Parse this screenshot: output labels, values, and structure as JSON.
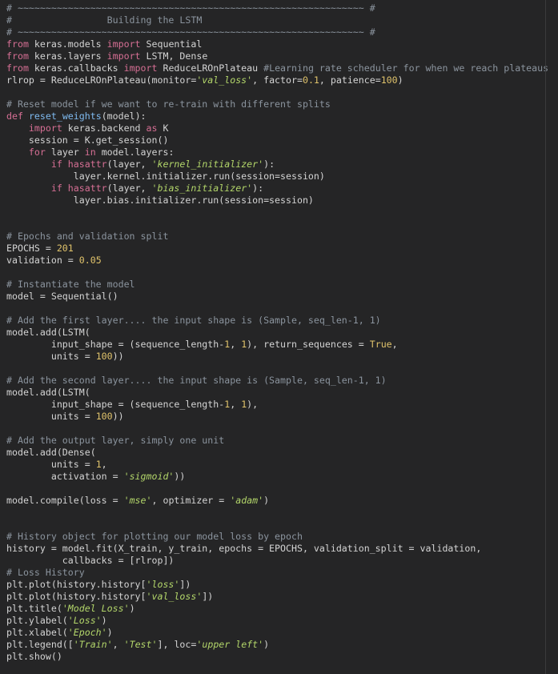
{
  "colors": {
    "background": "#252526",
    "text": "#d4d4d4",
    "keyword": "#d66f94",
    "comment": "#8b949e",
    "string": "#b3d66a",
    "number": "#e0c36b",
    "function": "#7fbaf0"
  },
  "code": {
    "lines": [
      [
        {
          "t": "cm",
          "v": "# ~~~~~~~~~~~~~~~~~~~~~~~~~~~~~~~~~~~~~~~~~~~~~~~~~~~~~~~~~~~~~~ #"
        }
      ],
      [
        {
          "t": "cm",
          "v": "#                 Building the LSTM"
        }
      ],
      [
        {
          "t": "cm",
          "v": "# ~~~~~~~~~~~~~~~~~~~~~~~~~~~~~~~~~~~~~~~~~~~~~~~~~~~~~~~~~~~~~~ #"
        }
      ],
      [
        {
          "t": "kw",
          "v": "from"
        },
        {
          "t": "tx",
          "v": " keras.models "
        },
        {
          "t": "kw",
          "v": "import"
        },
        {
          "t": "tx",
          "v": " Sequential"
        }
      ],
      [
        {
          "t": "kw",
          "v": "from"
        },
        {
          "t": "tx",
          "v": " keras.layers "
        },
        {
          "t": "kw",
          "v": "import"
        },
        {
          "t": "tx",
          "v": " LSTM, Dense"
        }
      ],
      [
        {
          "t": "kw",
          "v": "from"
        },
        {
          "t": "tx",
          "v": " keras.callbacks "
        },
        {
          "t": "kw",
          "v": "import"
        },
        {
          "t": "tx",
          "v": " ReduceLROnPlateau "
        },
        {
          "t": "cm",
          "v": "#Learning rate scheduler for when we reach plateaus"
        }
      ],
      [
        {
          "t": "tx",
          "v": "rlrop = ReduceLROnPlateau(monitor="
        },
        {
          "t": "str",
          "v": "'val_loss'"
        },
        {
          "t": "tx",
          "v": ", factor="
        },
        {
          "t": "num",
          "v": "0.1"
        },
        {
          "t": "tx",
          "v": ", patience="
        },
        {
          "t": "num",
          "v": "100"
        },
        {
          "t": "tx",
          "v": ")"
        }
      ],
      [],
      [
        {
          "t": "cm",
          "v": "# Reset model if we want to re-train with different splits"
        }
      ],
      [
        {
          "t": "kw",
          "v": "def"
        },
        {
          "t": "tx",
          "v": " "
        },
        {
          "t": "fn",
          "v": "reset_weights"
        },
        {
          "t": "tx",
          "v": "(model):"
        }
      ],
      [
        {
          "t": "tx",
          "v": "    "
        },
        {
          "t": "kw",
          "v": "import"
        },
        {
          "t": "tx",
          "v": " keras.backend "
        },
        {
          "t": "kw",
          "v": "as"
        },
        {
          "t": "tx",
          "v": " K"
        }
      ],
      [
        {
          "t": "tx",
          "v": "    session = K.get_session()"
        }
      ],
      [
        {
          "t": "tx",
          "v": "    "
        },
        {
          "t": "kw",
          "v": "for"
        },
        {
          "t": "tx",
          "v": " layer "
        },
        {
          "t": "kw",
          "v": "in"
        },
        {
          "t": "tx",
          "v": " model.layers:"
        }
      ],
      [
        {
          "t": "tx",
          "v": "        "
        },
        {
          "t": "kw",
          "v": "if"
        },
        {
          "t": "tx",
          "v": " "
        },
        {
          "t": "kw",
          "v": "hasattr"
        },
        {
          "t": "tx",
          "v": "(layer, "
        },
        {
          "t": "str",
          "v": "'kernel_initializer'"
        },
        {
          "t": "tx",
          "v": "):"
        }
      ],
      [
        {
          "t": "tx",
          "v": "            layer.kernel.initializer.run(session=session)"
        }
      ],
      [
        {
          "t": "tx",
          "v": "        "
        },
        {
          "t": "kw",
          "v": "if"
        },
        {
          "t": "tx",
          "v": " "
        },
        {
          "t": "kw",
          "v": "hasattr"
        },
        {
          "t": "tx",
          "v": "(layer, "
        },
        {
          "t": "str",
          "v": "'bias_initializer'"
        },
        {
          "t": "tx",
          "v": "):"
        }
      ],
      [
        {
          "t": "tx",
          "v": "            layer.bias.initializer.run(session=session)"
        }
      ],
      [],
      [],
      [
        {
          "t": "cm",
          "v": "# Epochs and validation split"
        }
      ],
      [
        {
          "t": "tx",
          "v": "EPOCHS = "
        },
        {
          "t": "num",
          "v": "201"
        }
      ],
      [
        {
          "t": "tx",
          "v": "validation = "
        },
        {
          "t": "num",
          "v": "0.05"
        }
      ],
      [],
      [
        {
          "t": "cm",
          "v": "# Instantiate the model"
        }
      ],
      [
        {
          "t": "tx",
          "v": "model = Sequential()"
        }
      ],
      [],
      [
        {
          "t": "cm",
          "v": "# Add the first layer.... the input shape is (Sample, seq_len-1, 1)"
        }
      ],
      [
        {
          "t": "tx",
          "v": "model.add(LSTM("
        }
      ],
      [
        {
          "t": "tx",
          "v": "        input_shape = (sequence_length-"
        },
        {
          "t": "num",
          "v": "1"
        },
        {
          "t": "tx",
          "v": ", "
        },
        {
          "t": "num",
          "v": "1"
        },
        {
          "t": "tx",
          "v": "), return_sequences = "
        },
        {
          "t": "num",
          "v": "True"
        },
        {
          "t": "tx",
          "v": ","
        }
      ],
      [
        {
          "t": "tx",
          "v": "        units = "
        },
        {
          "t": "num",
          "v": "100"
        },
        {
          "t": "tx",
          "v": "))"
        }
      ],
      [],
      [
        {
          "t": "cm",
          "v": "# Add the second layer.... the input shape is (Sample, seq_len-1, 1)"
        }
      ],
      [
        {
          "t": "tx",
          "v": "model.add(LSTM("
        }
      ],
      [
        {
          "t": "tx",
          "v": "        input_shape = (sequence_length-"
        },
        {
          "t": "num",
          "v": "1"
        },
        {
          "t": "tx",
          "v": ", "
        },
        {
          "t": "num",
          "v": "1"
        },
        {
          "t": "tx",
          "v": "),"
        }
      ],
      [
        {
          "t": "tx",
          "v": "        units = "
        },
        {
          "t": "num",
          "v": "100"
        },
        {
          "t": "tx",
          "v": "))"
        }
      ],
      [],
      [
        {
          "t": "cm",
          "v": "# Add the output layer, simply one unit"
        }
      ],
      [
        {
          "t": "tx",
          "v": "model.add(Dense("
        }
      ],
      [
        {
          "t": "tx",
          "v": "        units = "
        },
        {
          "t": "num",
          "v": "1"
        },
        {
          "t": "tx",
          "v": ","
        }
      ],
      [
        {
          "t": "tx",
          "v": "        activation = "
        },
        {
          "t": "str",
          "v": "'sigmoid'"
        },
        {
          "t": "tx",
          "v": "))"
        }
      ],
      [],
      [
        {
          "t": "tx",
          "v": "model.compile(loss = "
        },
        {
          "t": "str",
          "v": "'mse'"
        },
        {
          "t": "tx",
          "v": ", optimizer = "
        },
        {
          "t": "str",
          "v": "'adam'"
        },
        {
          "t": "tx",
          "v": ")"
        }
      ],
      [],
      [],
      [
        {
          "t": "cm",
          "v": "# History object for plotting our model loss by epoch"
        }
      ],
      [
        {
          "t": "tx",
          "v": "history = model.fit(X_train, y_train, epochs = EPOCHS, validation_split = validation,"
        }
      ],
      [
        {
          "t": "tx",
          "v": "          callbacks = [rlrop])"
        }
      ],
      [
        {
          "t": "cm",
          "v": "# Loss History"
        }
      ],
      [
        {
          "t": "tx",
          "v": "plt.plot(history.history["
        },
        {
          "t": "str",
          "v": "'loss'"
        },
        {
          "t": "tx",
          "v": "])"
        }
      ],
      [
        {
          "t": "tx",
          "v": "plt.plot(history.history["
        },
        {
          "t": "str",
          "v": "'val_loss'"
        },
        {
          "t": "tx",
          "v": "])"
        }
      ],
      [
        {
          "t": "tx",
          "v": "plt.title("
        },
        {
          "t": "str",
          "v": "'Model Loss'"
        },
        {
          "t": "tx",
          "v": ")"
        }
      ],
      [
        {
          "t": "tx",
          "v": "plt.ylabel("
        },
        {
          "t": "str",
          "v": "'Loss'"
        },
        {
          "t": "tx",
          "v": ")"
        }
      ],
      [
        {
          "t": "tx",
          "v": "plt.xlabel("
        },
        {
          "t": "str",
          "v": "'Epoch'"
        },
        {
          "t": "tx",
          "v": ")"
        }
      ],
      [
        {
          "t": "tx",
          "v": "plt.legend(["
        },
        {
          "t": "str",
          "v": "'Train'"
        },
        {
          "t": "tx",
          "v": ", "
        },
        {
          "t": "str",
          "v": "'Test'"
        },
        {
          "t": "tx",
          "v": "], loc="
        },
        {
          "t": "str",
          "v": "'upper left'"
        },
        {
          "t": "tx",
          "v": ")"
        }
      ],
      [
        {
          "t": "tx",
          "v": "plt.show()"
        }
      ]
    ]
  }
}
